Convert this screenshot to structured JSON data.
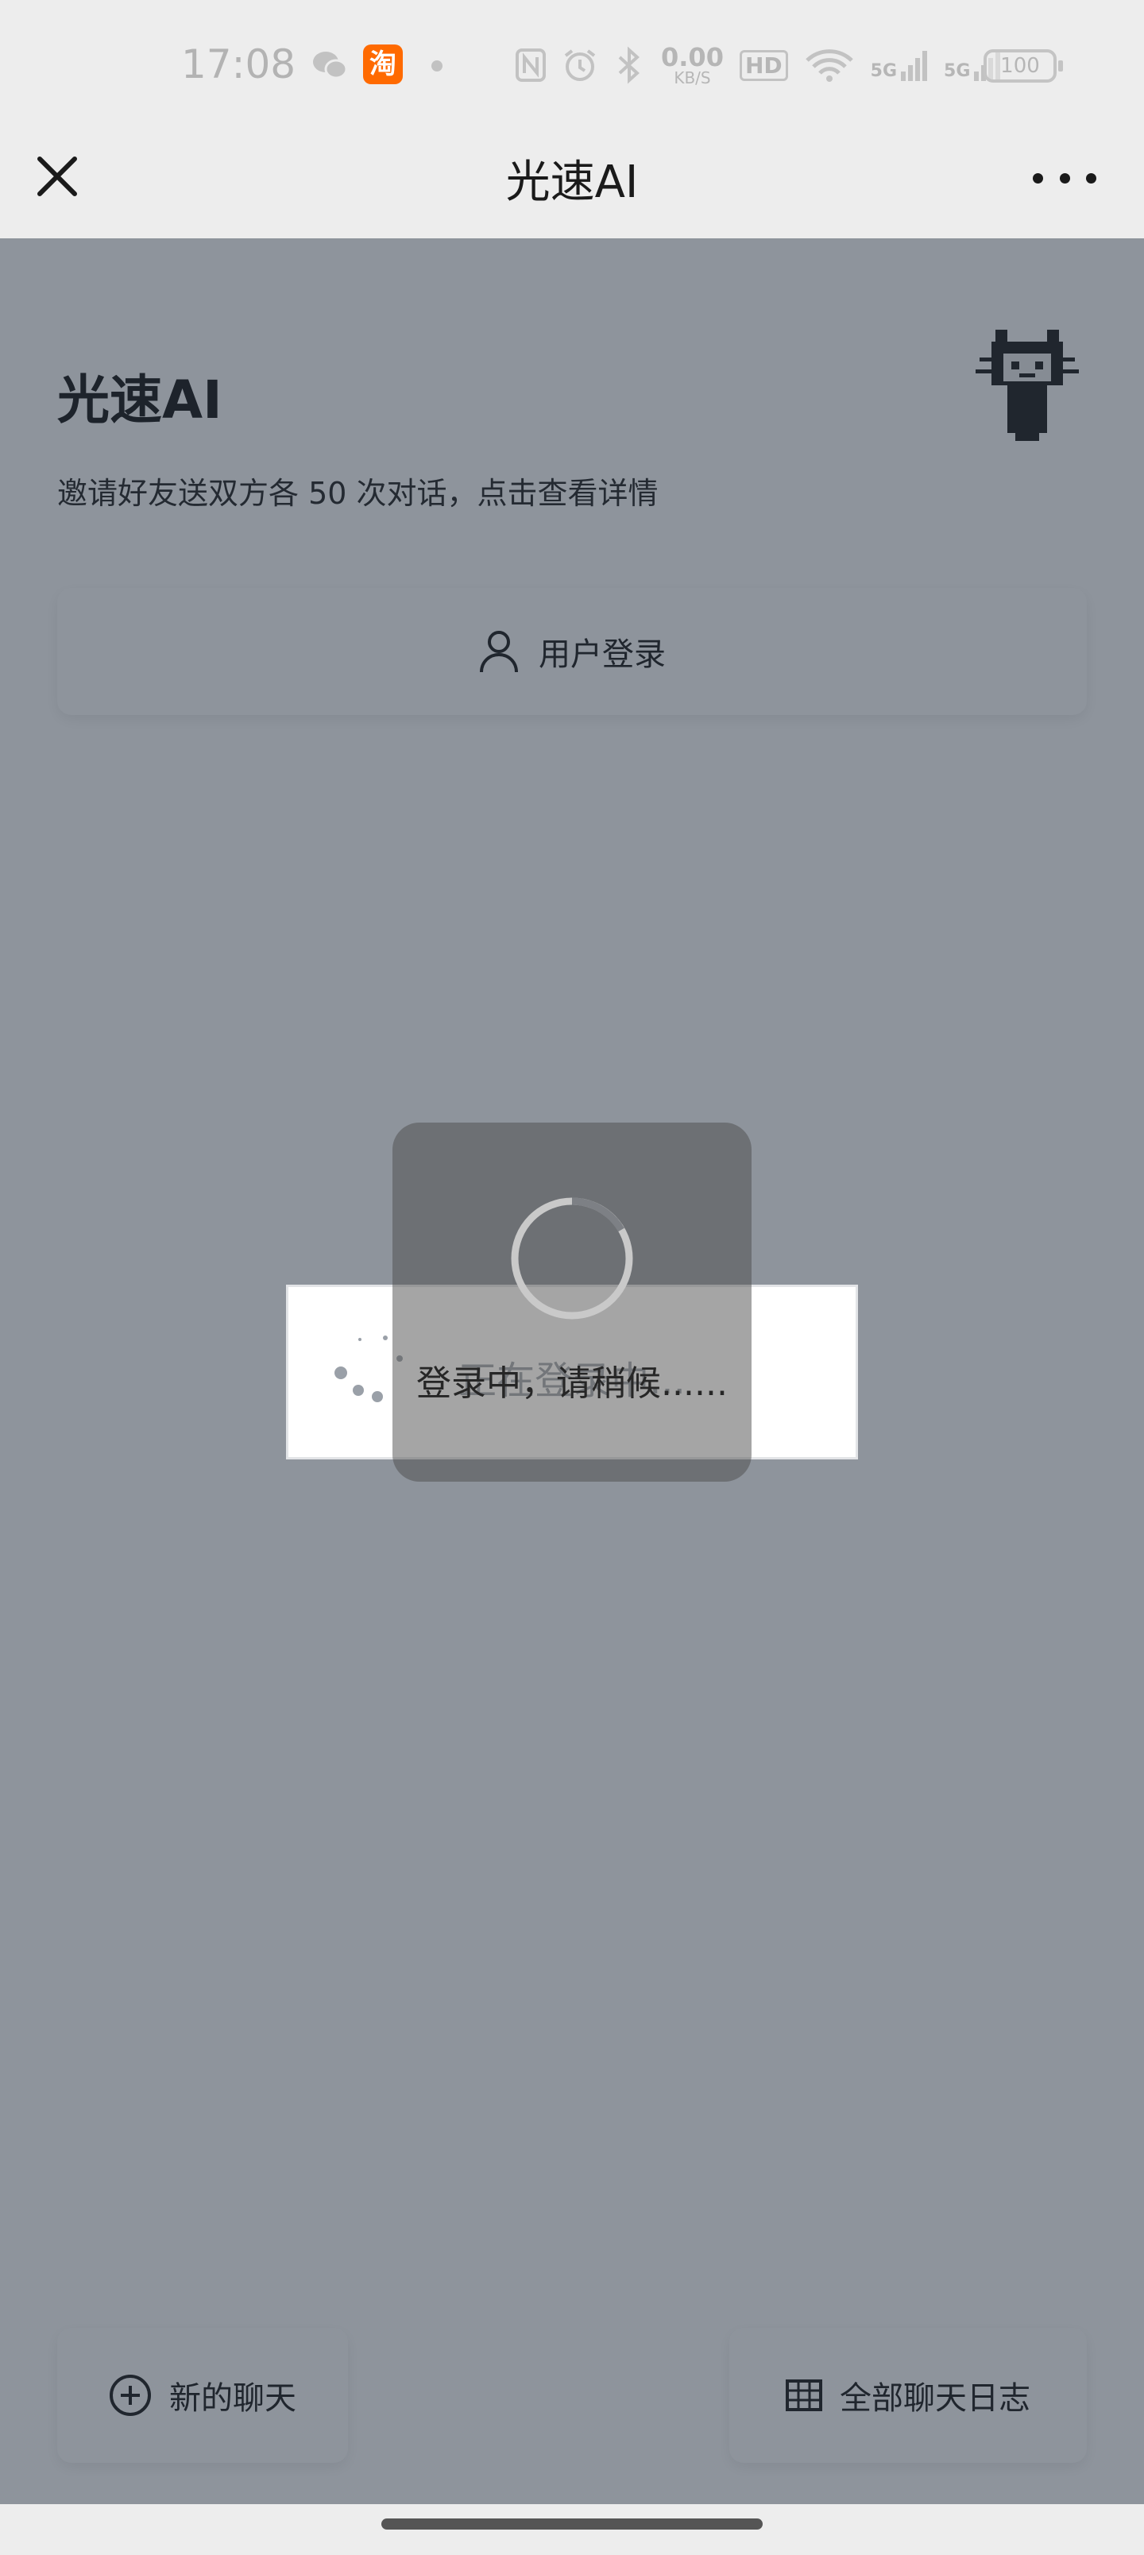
{
  "status_bar": {
    "time": "17:08",
    "network_speed_value": "0.00",
    "network_speed_unit": "KB/S",
    "hd_label": "HD",
    "signal_1": "5G",
    "signal_2": "5G",
    "battery": "100",
    "taobao_label": "淘"
  },
  "title_bar": {
    "title": "光速AI"
  },
  "page": {
    "brand_title": "光速AI",
    "invite_text": "邀请好友送双方各 50 次对话，点击查看详情",
    "login_label": "用户登录",
    "new_chat_label": "新的聊天",
    "all_logs_label": "全部聊天日志"
  },
  "inner_loading": {
    "text": "正在登录中..."
  },
  "toast": {
    "text": "登录中，请稍候......"
  },
  "colors": {
    "overlay": "#1d2939",
    "taobao": "#ff6a00",
    "background": "#ededed"
  }
}
